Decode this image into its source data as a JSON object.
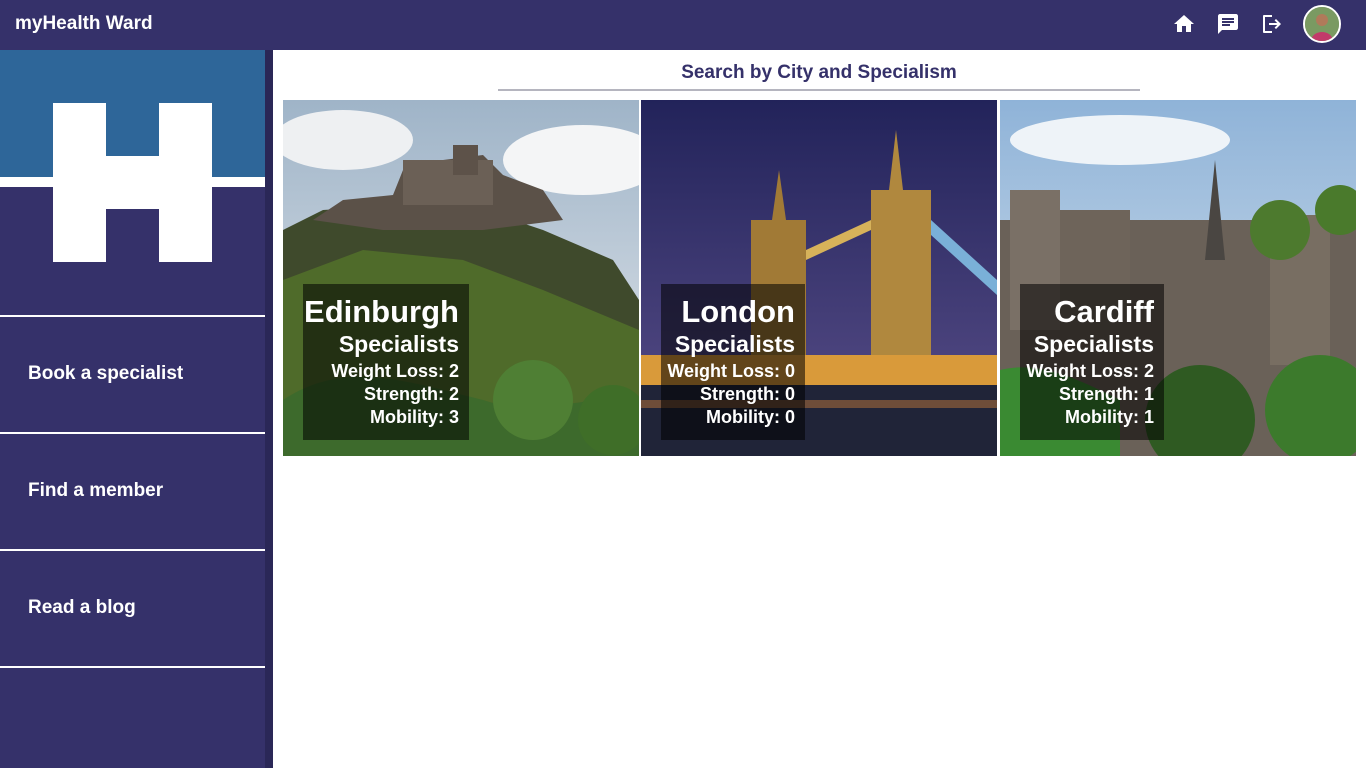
{
  "header": {
    "app_title": "myHealth Ward",
    "icons": [
      "home-icon",
      "chat-icon",
      "logout-icon"
    ],
    "avatar": "user-avatar"
  },
  "sidebar": {
    "items": [
      {
        "label": "Book a specialist"
      },
      {
        "label": "Find a member"
      },
      {
        "label": "Read a blog"
      }
    ]
  },
  "main": {
    "title": "Search by City and Specialism",
    "cities": [
      {
        "name": "Edinburgh",
        "specialists_label": "Specialists",
        "weight_loss": "Weight Loss: 2",
        "strength": "Strength: 2",
        "mobility": "Mobility: 3"
      },
      {
        "name": "London",
        "specialists_label": "Specialists",
        "weight_loss": "Weight Loss: 0",
        "strength": "Strength: 0",
        "mobility": "Mobility: 0"
      },
      {
        "name": "Cardiff",
        "specialists_label": "Specialists",
        "weight_loss": "Weight Loss: 2",
        "strength": "Strength: 1",
        "mobility": "Mobility: 1"
      }
    ]
  },
  "colors": {
    "brand": "#35316a",
    "logo_blue": "#2e6699",
    "white": "#ffffff"
  }
}
